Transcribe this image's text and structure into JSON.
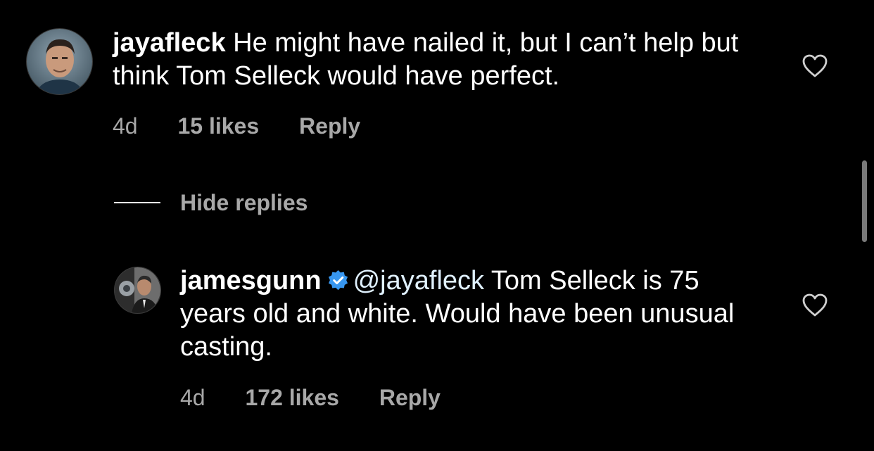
{
  "comments": [
    {
      "username": "jayafleck",
      "text": "He might have nailed it, but I can’t help but think Tom Selleck would have perfect.",
      "time": "4d",
      "likes": "15 likes",
      "reply": "Reply",
      "avatar_icon": "avatar-photo-icon",
      "like_icon": "heart-outline-icon"
    }
  ],
  "replies_toggle": {
    "label": "Hide replies"
  },
  "replies": [
    {
      "username": "jamesgunn",
      "verified": true,
      "mention": "@jayafleck",
      "text": " Tom Selleck is 75 years old and white. Would have been unusual casting.",
      "time": "4d",
      "likes": "172 likes",
      "reply": "Reply",
      "avatar_icon": "avatar-photo-icon",
      "verified_icon": "verified-badge-icon",
      "like_icon": "heart-outline-icon"
    }
  ],
  "colors": {
    "background": "#000000",
    "text": "#ffffff",
    "secondary_text": "#a8a8a8",
    "verified_blue": "#3897f0"
  }
}
